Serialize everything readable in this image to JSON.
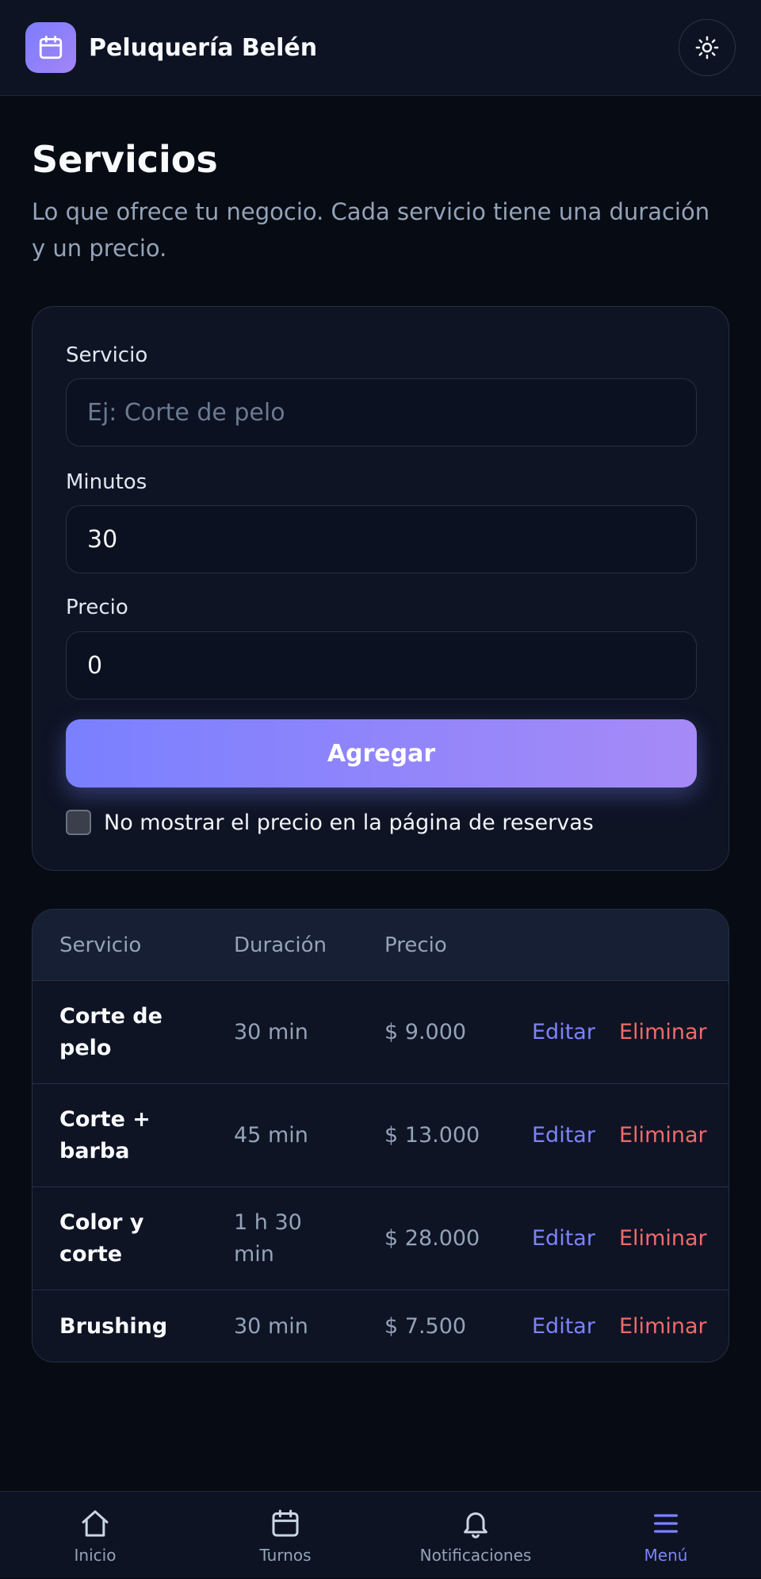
{
  "header": {
    "brand": "Peluquería Belén",
    "logo_icon": "calendar-icon",
    "theme_icon": "sun-icon"
  },
  "page": {
    "title": "Servicios",
    "subtitle": "Lo que ofrece tu negocio. Cada servicio tiene una duración y un precio."
  },
  "form": {
    "service_label": "Servicio",
    "service_placeholder": "Ej: Corte de pelo",
    "service_value": "",
    "minutes_label": "Minutos",
    "minutes_value": "30",
    "price_label": "Precio",
    "price_value": "0",
    "add_label": "Agregar",
    "hide_price_label": "No mostrar el precio en la página de reservas",
    "hide_price_checked": false
  },
  "table": {
    "headers": [
      "Servicio",
      "Duración",
      "Precio"
    ],
    "rows": [
      {
        "name": "Corte de pelo",
        "duration": "30 min",
        "price": "$ 9.000",
        "edit": "Editar",
        "delete": "Eliminar"
      },
      {
        "name": "Corte + barba",
        "duration": "45 min",
        "price": "$ 13.000",
        "edit": "Editar",
        "delete": "Eliminar"
      },
      {
        "name": "Color y corte",
        "duration": "1 h 30 min",
        "price": "$ 28.000",
        "edit": "Editar",
        "delete": "Eliminar"
      },
      {
        "name": "Brushing",
        "duration": "30 min",
        "price": "$ 7.500",
        "edit": "Editar",
        "delete": "Eliminar"
      }
    ]
  },
  "nav": {
    "items": [
      {
        "label": "Inicio",
        "icon": "home-icon"
      },
      {
        "label": "Turnos",
        "icon": "calendar-icon"
      },
      {
        "label": "Notificaciones",
        "icon": "bell-icon"
      },
      {
        "label": "Menú",
        "icon": "menu-icon"
      }
    ],
    "active": "Menú"
  },
  "colors": {
    "background": "#070b14",
    "surface": "#0e1424",
    "accent": "#7c83ff",
    "danger": "#f26a6a",
    "muted": "#94a3b8"
  }
}
